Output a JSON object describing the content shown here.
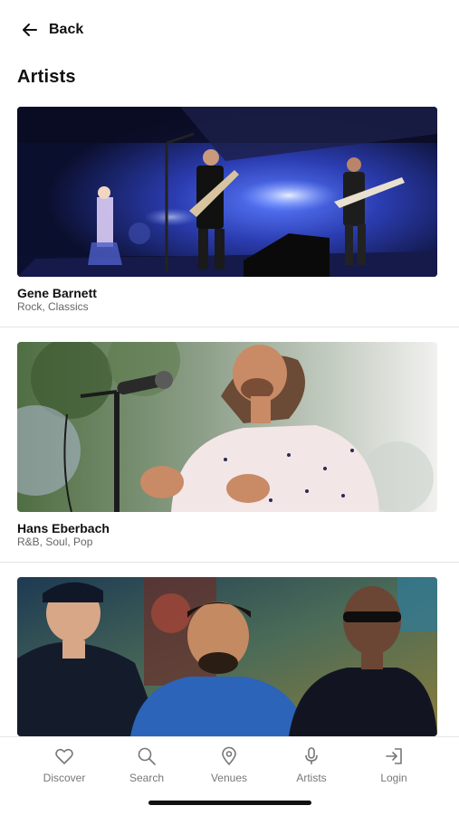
{
  "header": {
    "back_label": "Back",
    "title": "Artists"
  },
  "artists": [
    {
      "name": "Gene Barnett",
      "genres": "Rock, Classics"
    },
    {
      "name": "Hans Eberbach",
      "genres": "R&B, Soul, Pop"
    },
    {
      "name": "",
      "genres": ""
    }
  ],
  "tabbar": {
    "items": [
      {
        "label": "Discover",
        "icon": "heart-icon"
      },
      {
        "label": "Search",
        "icon": "search-icon"
      },
      {
        "label": "Venues",
        "icon": "location-pin-icon"
      },
      {
        "label": "Artists",
        "icon": "microphone-icon"
      },
      {
        "label": "Login",
        "icon": "login-icon"
      }
    ]
  },
  "colors": {
    "accent": "#111111",
    "muted": "#777777",
    "divider": "#e4e4e4"
  }
}
